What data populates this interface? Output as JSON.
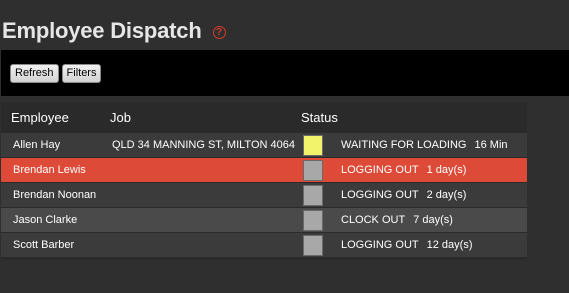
{
  "page": {
    "title": "Employee Dispatch",
    "help_icon": "question-circle-icon"
  },
  "toolbar": {
    "refresh_label": "Refresh",
    "filters_label": "Filters"
  },
  "table": {
    "columns": {
      "employee": "Employee",
      "job": "Job",
      "status": "Status"
    },
    "rows": [
      {
        "employee": "Allen Hay",
        "job": "QLD 34 MANNING ST, MILTON 4064",
        "status_color": "#f2f26b",
        "status": "WAITING FOR LOADING",
        "duration": "16 Min"
      },
      {
        "employee": "Brendan Lewis",
        "job": "",
        "status_color": "#a8a8a8",
        "status": "LOGGING OUT",
        "duration": "1 day(s)"
      },
      {
        "employee": "Brendan Noonan",
        "job": "",
        "status_color": "#a8a8a8",
        "status": "LOGGING OUT",
        "duration": "2 day(s)"
      },
      {
        "employee": "Jason Clarke",
        "job": "",
        "status_color": "#a8a8a8",
        "status": "CLOCK OUT",
        "duration": "7 day(s)"
      },
      {
        "employee": "Scott Barber",
        "job": "",
        "status_color": "#a8a8a8",
        "status": "LOGGING OUT",
        "duration": "12 day(s)"
      }
    ]
  },
  "colors": {
    "background": "#2f2f2f",
    "toolbar": "#000000",
    "row": "#3b3b3b",
    "row_alt": "#4a4a4a",
    "row_highlight": "#dd4a38",
    "help_icon": "#d93b2a"
  }
}
